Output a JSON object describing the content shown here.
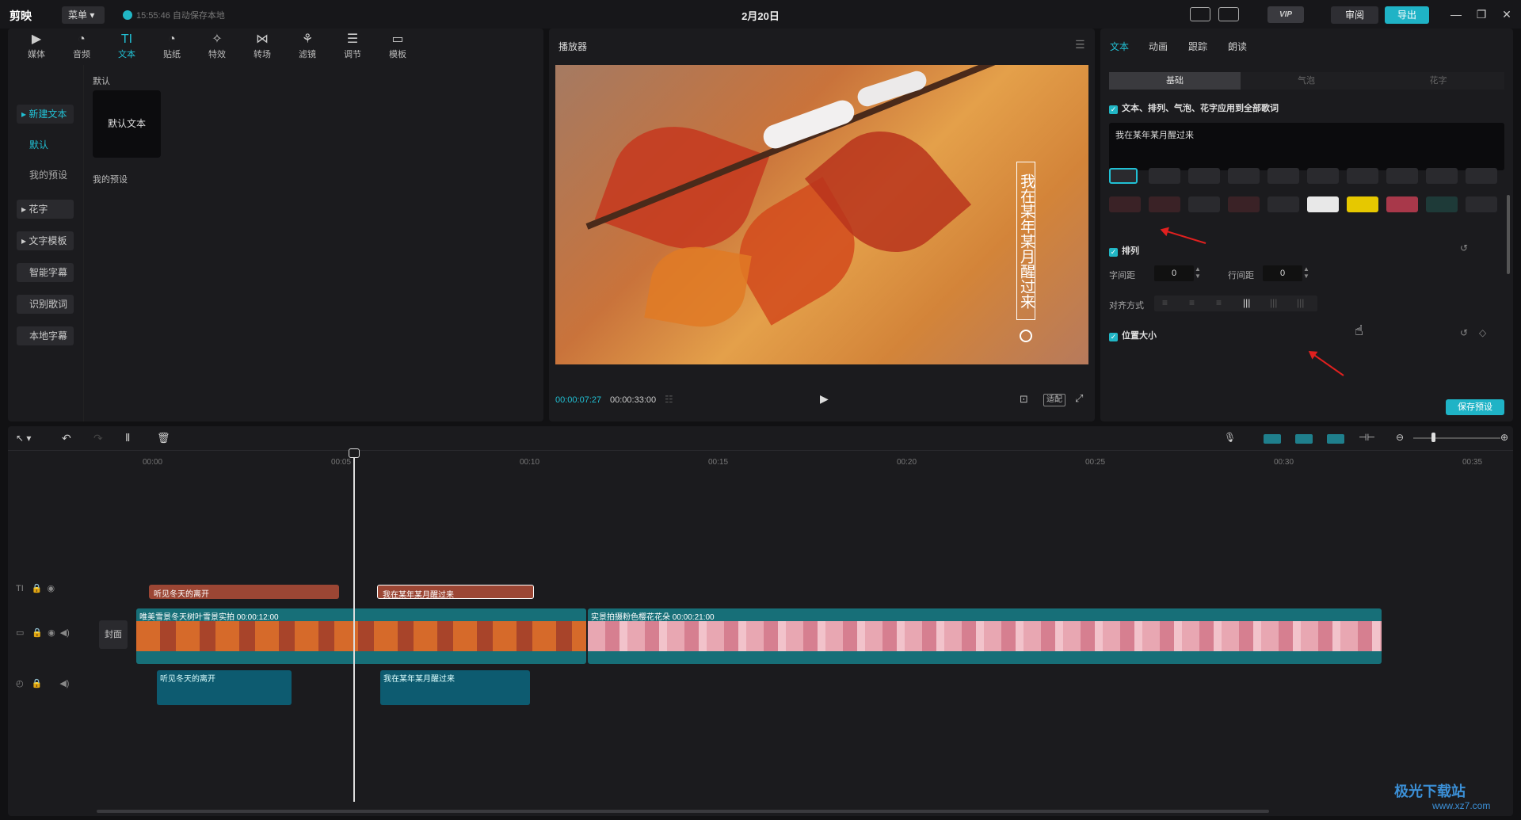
{
  "titlebar": {
    "app_name": "剪映",
    "menu_label": "菜单",
    "save_status": "15:55:46 自动保存本地",
    "project_title": "2月20日",
    "vip_label": "VIP",
    "review_label": "审阅",
    "export_label": "导出"
  },
  "top_tabs": [
    {
      "icon": "media-icon",
      "label": "媒体"
    },
    {
      "icon": "audio-icon",
      "label": "音频"
    },
    {
      "icon": "text-icon",
      "label": "文本"
    },
    {
      "icon": "sticker-icon",
      "label": "贴纸"
    },
    {
      "icon": "effects-icon",
      "label": "特效"
    },
    {
      "icon": "transition-icon",
      "label": "转场"
    },
    {
      "icon": "filter-icon",
      "label": "滤镜"
    },
    {
      "icon": "adjust-icon",
      "label": "调节"
    },
    {
      "icon": "template-icon",
      "label": "模板"
    }
  ],
  "sidebar": {
    "new_text": "新建文本",
    "default": "默认",
    "my_presets": "我的预设",
    "flower_text": "花字",
    "text_template": "文字模板",
    "smart_caption": "智能字幕",
    "lyrics": "识别歌词",
    "local_caption": "本地字幕"
  },
  "library": {
    "section_default": "默认",
    "card_default_text": "默认文本",
    "section_my_presets": "我的预设"
  },
  "player": {
    "title": "播放器",
    "subtitle_text": "我在某年某月醒过来",
    "current_time": "00:00:07:27",
    "total_time": "00:00:33:00",
    "ratio_label": "适配"
  },
  "props": {
    "tabs": [
      "文本",
      "动画",
      "跟踪",
      "朗读"
    ],
    "segments": [
      "基础",
      "气泡",
      "花字"
    ],
    "apply_all": "文本、排列、气泡、花字应用到全部歌词",
    "text_value": "我在某年某月醒过来",
    "arrange_label": "排列",
    "char_spacing_label": "字间距",
    "char_spacing": "0",
    "line_spacing_label": "行间距",
    "line_spacing": "0",
    "align_label": "对齐方式",
    "position_label": "位置大小",
    "save_preset": "保存预设"
  },
  "timeline": {
    "ruler_ticks": [
      "00:00",
      "00:05",
      "00:10",
      "00:15",
      "00:20",
      "00:25",
      "00:30",
      "00:35"
    ],
    "cover_label": "封面",
    "text_clips": [
      "听见冬天的离开",
      "我在某年某月醒过来"
    ],
    "video_clips": [
      {
        "name": "唯美雪景冬天树叶雪景实拍",
        "duration": "00:00:12:00"
      },
      {
        "name": "实景拍摄粉色樱花花朵",
        "duration": "00:00:21:00"
      }
    ],
    "audio_clips": [
      "听见冬天的离开",
      "我在某年某月醒过来"
    ]
  },
  "watermark": {
    "name": "极光下载站",
    "url": "www.xz7.com"
  }
}
